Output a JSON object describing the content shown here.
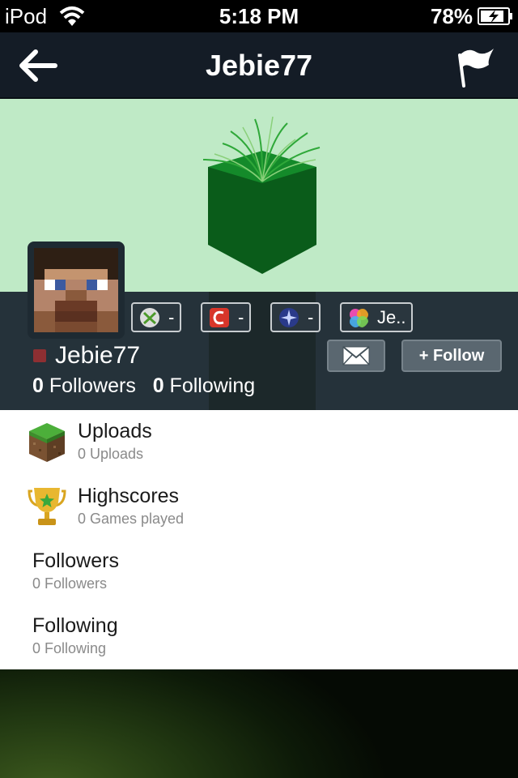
{
  "status_bar": {
    "carrier": "iPod",
    "time": "5:18 PM",
    "battery": "78%"
  },
  "nav": {
    "title": "Jebie77",
    "back_icon": "back-arrow-icon",
    "flag_icon": "flag-icon"
  },
  "profile": {
    "username": "Jebie77",
    "followers_count": "0",
    "followers_label": "Followers",
    "following_count": "0",
    "following_label": "Following",
    "status_color": "#8e2f32",
    "follow_label": "+ Follow",
    "badges": [
      {
        "icon": "xbox-icon",
        "value": "-"
      },
      {
        "icon": "game-center-red-icon",
        "value": "-"
      },
      {
        "icon": "playstation-network-icon",
        "value": "-"
      },
      {
        "icon": "game-center-icon",
        "value": "Je.."
      }
    ]
  },
  "menu": [
    {
      "title": "Uploads",
      "subtitle": "0 Uploads",
      "icon": "grass-block-icon"
    },
    {
      "title": "Highscores",
      "subtitle": "0 Games played",
      "icon": "trophy-icon"
    },
    {
      "title": "Followers",
      "subtitle": "0 Followers"
    },
    {
      "title": "Following",
      "subtitle": "0 Following"
    }
  ],
  "colors": {
    "nav_bg": "#141c26",
    "banner_bg": "#bfeac6",
    "panel_bg": "#25323a"
  }
}
